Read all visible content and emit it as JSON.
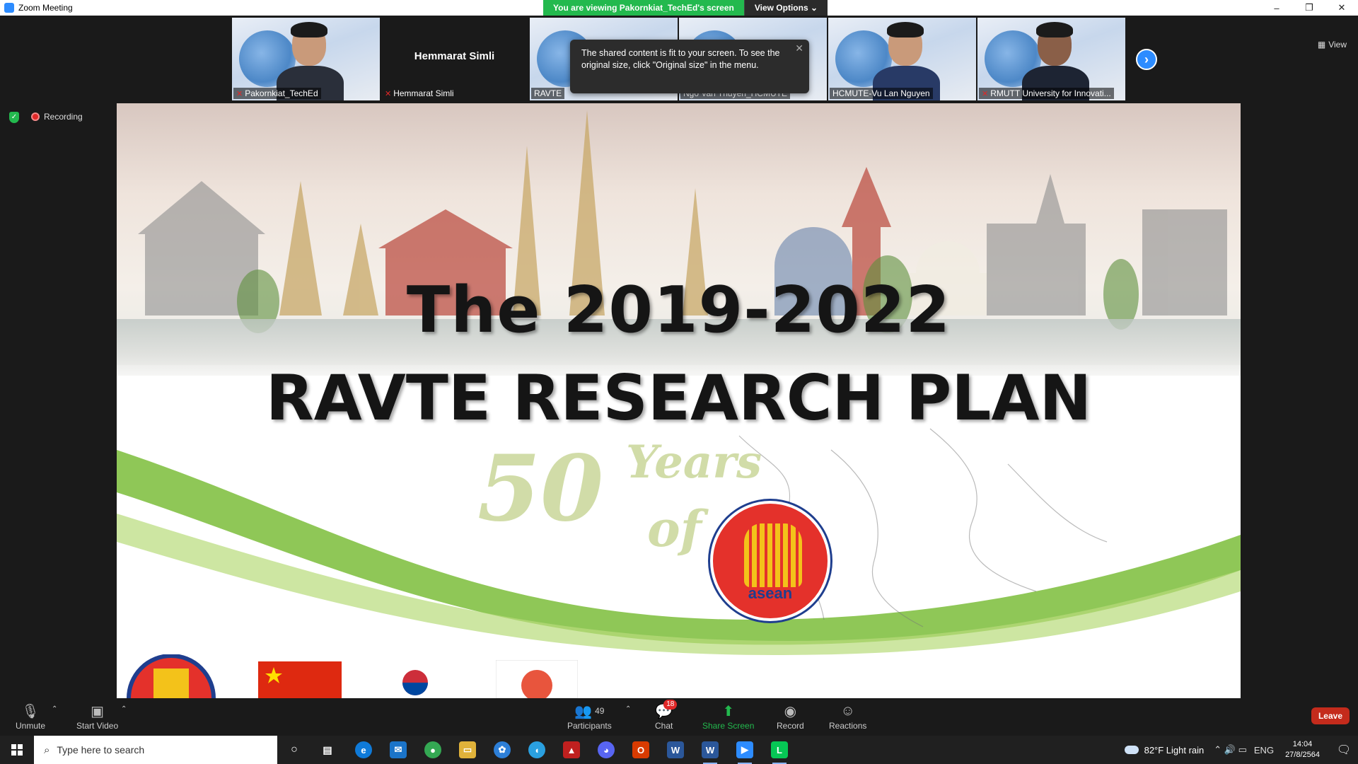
{
  "window": {
    "title": "Zoom Meeting",
    "controls": {
      "minimize": "–",
      "restore": "❐",
      "close": "✕"
    }
  },
  "banner": {
    "viewing": "You are viewing Pakornkiat_TechEd's screen",
    "view_options": "View Options ⌄"
  },
  "gallery": {
    "tiles": [
      {
        "name": "Pakornkiat_TechEd",
        "muted": true,
        "active": true
      },
      {
        "name": "Hemmarat Simli",
        "muted": true,
        "center_name": "Hemmarat Simli"
      },
      {
        "name": "RAVTE",
        "muted": false
      },
      {
        "name": "Ngo Van Thuyen_HCMUTE",
        "muted": false
      },
      {
        "name": "HCMUTE-Vu Lan Nguyen",
        "muted": false
      },
      {
        "name": "RMUTT University for Innovati...",
        "muted": true
      }
    ],
    "next_icon": "chevron-right-icon",
    "view_label": "View"
  },
  "tooltip": {
    "text": "The shared content is fit to your screen. To see the original size, click \"Original size\" in the menu."
  },
  "status": {
    "recording": "Recording"
  },
  "slide": {
    "title_line1": "The 2019-2022",
    "title_line2": "RAVTE RESEARCH PLAN",
    "years_number": "50",
    "years_word": "Years",
    "years_of": "of",
    "logo_word": "asean"
  },
  "toolbar": {
    "unmute": "Unmute",
    "start_video": "Start Video",
    "participants": "Participants",
    "participants_count": "49",
    "chat": "Chat",
    "chat_badge": "18",
    "share_screen": "Share Screen",
    "record": "Record",
    "reactions": "Reactions",
    "leave": "Leave"
  },
  "taskbar": {
    "search_placeholder": "Type here to search",
    "weather": "82°F  Light rain",
    "language": "ENG",
    "time": "14:04",
    "date": "27/8/2564"
  },
  "colors": {
    "zoom_blue": "#2d8cff",
    "share_green": "#23b94e",
    "leave_red": "#c42b1c",
    "recording_red": "#e02828"
  }
}
